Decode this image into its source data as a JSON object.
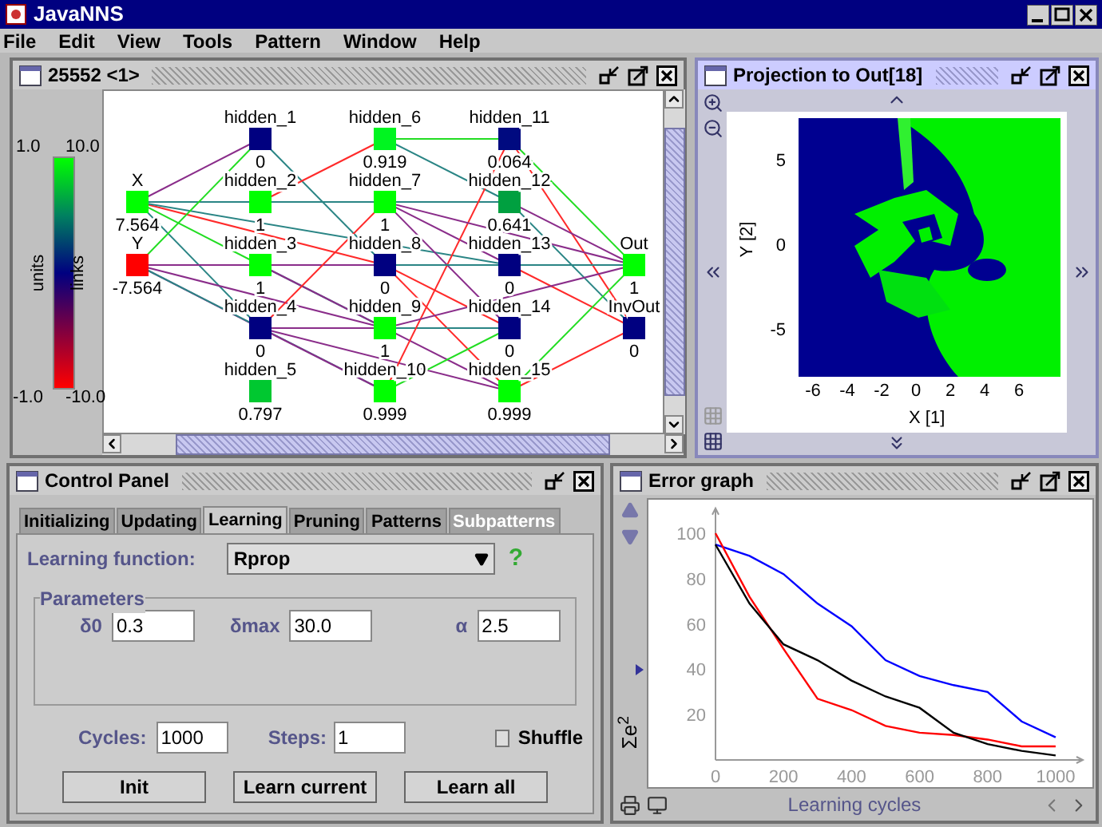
{
  "app": {
    "title": "JavaNNS"
  },
  "menu": [
    "File",
    "Edit",
    "View",
    "Tools",
    "Pattern",
    "Window",
    "Help"
  ],
  "network_window": {
    "title": "25552 <1>",
    "active": false,
    "maximizable": true,
    "legend": {
      "units_label": "units",
      "links_label": "links",
      "units_max": "1.0",
      "units_min": "-1.0",
      "links_max": "10.0",
      "links_min": "-10.0"
    },
    "layers": [
      [
        {
          "name": "X",
          "value": "7.564",
          "color": "#00ff00"
        },
        {
          "name": "Y",
          "value": "-7.564",
          "color": "#ff0000"
        }
      ],
      [
        {
          "name": "hidden_1",
          "value": "0",
          "color": "#000080"
        },
        {
          "name": "hidden_2",
          "value": "1",
          "color": "#00ff00"
        },
        {
          "name": "hidden_3",
          "value": "1",
          "color": "#00ff00"
        },
        {
          "name": "hidden_4",
          "value": "0",
          "color": "#000080"
        },
        {
          "name": "hidden_5",
          "value": "0.797",
          "color": "#00c830"
        }
      ],
      [
        {
          "name": "hidden_6",
          "value": "0.919",
          "color": "#00f520"
        },
        {
          "name": "hidden_7",
          "value": "1",
          "color": "#00ff00"
        },
        {
          "name": "hidden_8",
          "value": "0",
          "color": "#000080"
        },
        {
          "name": "hidden_9",
          "value": "1",
          "color": "#00ff00"
        },
        {
          "name": "hidden_10",
          "value": "0.999",
          "color": "#00ff00"
        }
      ],
      [
        {
          "name": "hidden_11",
          "value": "0.064",
          "color": "#000a80"
        },
        {
          "name": "hidden_12",
          "value": "0.641",
          "color": "#00a040"
        },
        {
          "name": "hidden_13",
          "value": "0",
          "color": "#000080"
        },
        {
          "name": "hidden_14",
          "value": "0",
          "color": "#000080"
        },
        {
          "name": "hidden_15",
          "value": "0.999",
          "color": "#00ff00"
        }
      ],
      [
        {
          "name": "Out",
          "value": "1",
          "color": "#00ff00"
        },
        {
          "name": "InvOut",
          "value": "0",
          "color": "#000080"
        }
      ]
    ]
  },
  "projection_window": {
    "title": "Projection to Out[18]",
    "active": true,
    "maximizable": true,
    "xlabel": "X [1]",
    "ylabel": "Y [2]",
    "xticks": [
      "-6",
      "-4",
      "-2",
      "0",
      "2",
      "4",
      "6"
    ],
    "yticks": [
      "5",
      "0",
      "-5"
    ]
  },
  "control_panel": {
    "title": "Control Panel",
    "active": false,
    "maximizable": false,
    "tabs": [
      {
        "label": "Initializing",
        "selected": false,
        "disabled": false
      },
      {
        "label": "Updating",
        "selected": false,
        "disabled": false
      },
      {
        "label": "Learning",
        "selected": true,
        "disabled": false
      },
      {
        "label": "Pruning",
        "selected": false,
        "disabled": false
      },
      {
        "label": "Patterns",
        "selected": false,
        "disabled": false
      },
      {
        "label": "Subpatterns",
        "selected": false,
        "disabled": true
      }
    ],
    "learning_function_label": "Learning function:",
    "learning_function": "Rprop",
    "help": "?",
    "parameters_title": "Parameters",
    "parameters": [
      {
        "label": "δ0",
        "value": "0.3"
      },
      {
        "label": "δmax",
        "value": "30.0"
      },
      {
        "label": "α",
        "value": "2.5"
      }
    ],
    "cycles_label": "Cycles:",
    "cycles": "1000",
    "steps_label": "Steps:",
    "steps": "1",
    "shuffle": {
      "label": "Shuffle",
      "checked": false
    },
    "buttons": [
      "Init",
      "Learn current",
      "Learn all"
    ]
  },
  "error_window": {
    "title": "Error graph",
    "active": false,
    "maximizable": true,
    "chart_data": {
      "type": "line",
      "xlabel": "Learning cycles",
      "ylabel": "Σe$^{2}$",
      "x": [
        0,
        100,
        200,
        300,
        400,
        500,
        600,
        700,
        800,
        900,
        1000
      ],
      "series": [
        {
          "color": "#0000ff",
          "values": [
            95,
            90,
            82,
            69,
            59,
            44,
            37,
            33,
            30,
            17,
            10
          ]
        },
        {
          "color": "#ff0000",
          "values": [
            100,
            72,
            49,
            27,
            22,
            15,
            12,
            11,
            9,
            6,
            6
          ]
        },
        {
          "color": "#000000",
          "values": [
            95,
            69,
            51,
            44,
            35,
            28,
            23,
            12,
            7,
            4,
            2
          ]
        }
      ],
      "xlim": [
        0,
        1080
      ],
      "ylim": [
        0,
        111
      ],
      "xticks": [
        0,
        200,
        400,
        600,
        800,
        1000
      ],
      "yticks": [
        20,
        40,
        60,
        80,
        100
      ]
    }
  }
}
